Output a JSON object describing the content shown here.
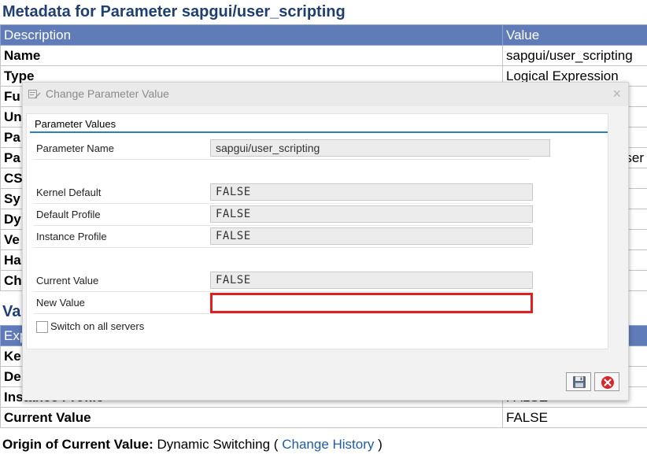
{
  "page": {
    "title": "Metadata for Parameter sapgui/user_scripting",
    "table1": {
      "headers": [
        "Description",
        "Value"
      ],
      "rows": [
        {
          "key": "Name",
          "value": "sapgui/user_scripting"
        },
        {
          "key": "Type",
          "value": "Logical Expression"
        },
        {
          "key": "Fu",
          "value": ""
        },
        {
          "key": "Un",
          "value": ""
        },
        {
          "key": "Pa",
          "value": ""
        },
        {
          "key": "Pa",
          "value": "ser"
        },
        {
          "key": "CS",
          "value": ""
        },
        {
          "key": "Sy",
          "value": ""
        },
        {
          "key": "Dy",
          "value": ""
        },
        {
          "key": "Ve",
          "value": ""
        },
        {
          "key": "Ha",
          "value": ""
        },
        {
          "key": "Ch",
          "value": ""
        }
      ]
    },
    "section2_title": "Va",
    "table2": {
      "headers": [
        "Exp",
        ""
      ],
      "rows": [
        {
          "key": "Ke",
          "value": ""
        },
        {
          "key": "De",
          "value": ""
        },
        {
          "key": "Instance Profile",
          "value": "FALSE"
        },
        {
          "key": "Current Value",
          "value": "FALSE"
        }
      ]
    },
    "origin": {
      "label": "Origin of Current Value:",
      "text": "Dynamic Switching (",
      "link": "Change History",
      "close": ")"
    }
  },
  "dialog": {
    "title": "Change Parameter Value",
    "close_glyph": "×",
    "group_title": "Parameter Values",
    "fields": {
      "parameter_name": {
        "label": "Parameter Name",
        "value": "sapgui/user_scripting"
      },
      "kernel_default": {
        "label": "Kernel Default",
        "value": "FALSE"
      },
      "default_profile": {
        "label": "Default Profile",
        "value": "FALSE"
      },
      "instance_profile": {
        "label": "Instance Profile",
        "value": "FALSE"
      },
      "current_value": {
        "label": "Current Value",
        "value": "FALSE"
      },
      "new_value": {
        "label": "New Value",
        "value": ""
      }
    },
    "switch_all_servers": {
      "label": "Switch on all servers",
      "checked": false
    },
    "buttons": {
      "save_icon": "save-icon",
      "cancel_icon": "cancel-icon"
    }
  },
  "colors": {
    "accent": "#2f7fc0",
    "header_bg": "#5f7bb8",
    "title_blue": "#1f3f72",
    "highlight_red": "#e02020",
    "cancel_red": "#d9262b"
  }
}
